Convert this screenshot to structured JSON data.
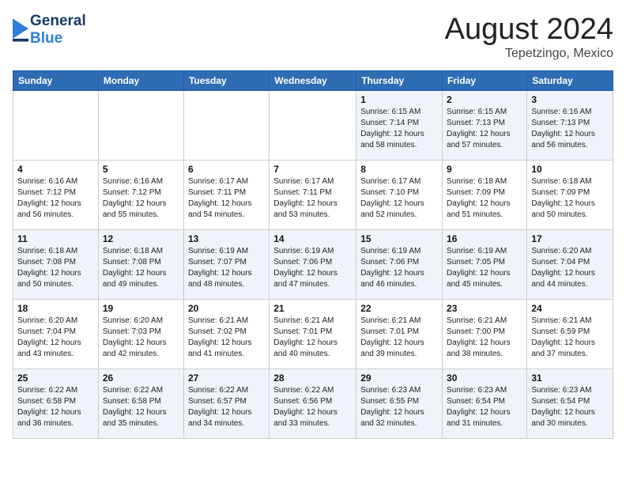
{
  "header": {
    "logo_general": "General",
    "logo_blue": "Blue",
    "title": "August 2024",
    "location": "Tepetzingo, Mexico"
  },
  "weekdays": [
    "Sunday",
    "Monday",
    "Tuesday",
    "Wednesday",
    "Thursday",
    "Friday",
    "Saturday"
  ],
  "weeks": [
    [
      {
        "day": "",
        "info": ""
      },
      {
        "day": "",
        "info": ""
      },
      {
        "day": "",
        "info": ""
      },
      {
        "day": "",
        "info": ""
      },
      {
        "day": "1",
        "info": "Sunrise: 6:15 AM\nSunset: 7:14 PM\nDaylight: 12 hours\nand 58 minutes."
      },
      {
        "day": "2",
        "info": "Sunrise: 6:15 AM\nSunset: 7:13 PM\nDaylight: 12 hours\nand 57 minutes."
      },
      {
        "day": "3",
        "info": "Sunrise: 6:16 AM\nSunset: 7:13 PM\nDaylight: 12 hours\nand 56 minutes."
      }
    ],
    [
      {
        "day": "4",
        "info": "Sunrise: 6:16 AM\nSunset: 7:12 PM\nDaylight: 12 hours\nand 56 minutes."
      },
      {
        "day": "5",
        "info": "Sunrise: 6:16 AM\nSunset: 7:12 PM\nDaylight: 12 hours\nand 55 minutes."
      },
      {
        "day": "6",
        "info": "Sunrise: 6:17 AM\nSunset: 7:11 PM\nDaylight: 12 hours\nand 54 minutes."
      },
      {
        "day": "7",
        "info": "Sunrise: 6:17 AM\nSunset: 7:11 PM\nDaylight: 12 hours\nand 53 minutes."
      },
      {
        "day": "8",
        "info": "Sunrise: 6:17 AM\nSunset: 7:10 PM\nDaylight: 12 hours\nand 52 minutes."
      },
      {
        "day": "9",
        "info": "Sunrise: 6:18 AM\nSunset: 7:09 PM\nDaylight: 12 hours\nand 51 minutes."
      },
      {
        "day": "10",
        "info": "Sunrise: 6:18 AM\nSunset: 7:09 PM\nDaylight: 12 hours\nand 50 minutes."
      }
    ],
    [
      {
        "day": "11",
        "info": "Sunrise: 6:18 AM\nSunset: 7:08 PM\nDaylight: 12 hours\nand 50 minutes."
      },
      {
        "day": "12",
        "info": "Sunrise: 6:18 AM\nSunset: 7:08 PM\nDaylight: 12 hours\nand 49 minutes."
      },
      {
        "day": "13",
        "info": "Sunrise: 6:19 AM\nSunset: 7:07 PM\nDaylight: 12 hours\nand 48 minutes."
      },
      {
        "day": "14",
        "info": "Sunrise: 6:19 AM\nSunset: 7:06 PM\nDaylight: 12 hours\nand 47 minutes."
      },
      {
        "day": "15",
        "info": "Sunrise: 6:19 AM\nSunset: 7:06 PM\nDaylight: 12 hours\nand 46 minutes."
      },
      {
        "day": "16",
        "info": "Sunrise: 6:19 AM\nSunset: 7:05 PM\nDaylight: 12 hours\nand 45 minutes."
      },
      {
        "day": "17",
        "info": "Sunrise: 6:20 AM\nSunset: 7:04 PM\nDaylight: 12 hours\nand 44 minutes."
      }
    ],
    [
      {
        "day": "18",
        "info": "Sunrise: 6:20 AM\nSunset: 7:04 PM\nDaylight: 12 hours\nand 43 minutes."
      },
      {
        "day": "19",
        "info": "Sunrise: 6:20 AM\nSunset: 7:03 PM\nDaylight: 12 hours\nand 42 minutes."
      },
      {
        "day": "20",
        "info": "Sunrise: 6:21 AM\nSunset: 7:02 PM\nDaylight: 12 hours\nand 41 minutes."
      },
      {
        "day": "21",
        "info": "Sunrise: 6:21 AM\nSunset: 7:01 PM\nDaylight: 12 hours\nand 40 minutes."
      },
      {
        "day": "22",
        "info": "Sunrise: 6:21 AM\nSunset: 7:01 PM\nDaylight: 12 hours\nand 39 minutes."
      },
      {
        "day": "23",
        "info": "Sunrise: 6:21 AM\nSunset: 7:00 PM\nDaylight: 12 hours\nand 38 minutes."
      },
      {
        "day": "24",
        "info": "Sunrise: 6:21 AM\nSunset: 6:59 PM\nDaylight: 12 hours\nand 37 minutes."
      }
    ],
    [
      {
        "day": "25",
        "info": "Sunrise: 6:22 AM\nSunset: 6:58 PM\nDaylight: 12 hours\nand 36 minutes."
      },
      {
        "day": "26",
        "info": "Sunrise: 6:22 AM\nSunset: 6:58 PM\nDaylight: 12 hours\nand 35 minutes."
      },
      {
        "day": "27",
        "info": "Sunrise: 6:22 AM\nSunset: 6:57 PM\nDaylight: 12 hours\nand 34 minutes."
      },
      {
        "day": "28",
        "info": "Sunrise: 6:22 AM\nSunset: 6:56 PM\nDaylight: 12 hours\nand 33 minutes."
      },
      {
        "day": "29",
        "info": "Sunrise: 6:23 AM\nSunset: 6:55 PM\nDaylight: 12 hours\nand 32 minutes."
      },
      {
        "day": "30",
        "info": "Sunrise: 6:23 AM\nSunset: 6:54 PM\nDaylight: 12 hours\nand 31 minutes."
      },
      {
        "day": "31",
        "info": "Sunrise: 6:23 AM\nSunset: 6:54 PM\nDaylight: 12 hours\nand 30 minutes."
      }
    ]
  ]
}
